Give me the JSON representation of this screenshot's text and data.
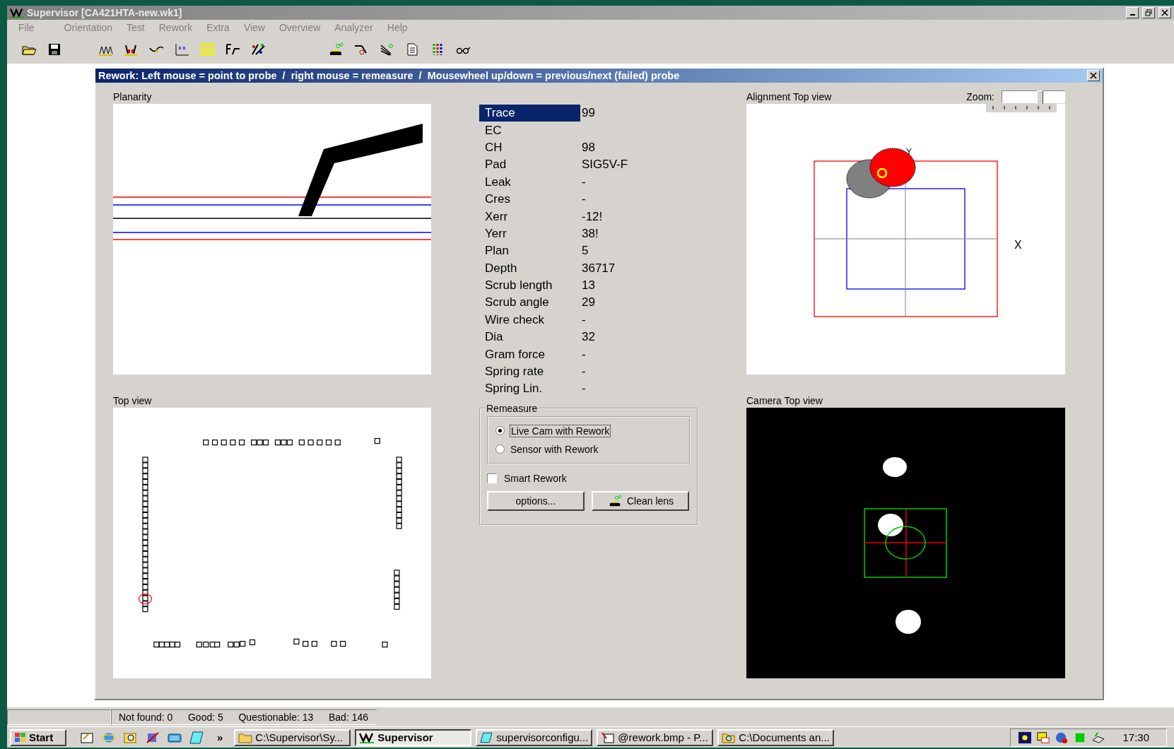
{
  "window": {
    "title": "Supervisor [CA421HTA-new.wk1]"
  },
  "menu": [
    "File",
    "Orientation",
    "Test",
    "Rework",
    "Extra",
    "View",
    "Overview",
    "Analyzer",
    "Help"
  ],
  "rework_panel": {
    "title": "Rework: Left mouse = point to probe  /  right mouse = remeasure  /  Mousewheel up/down = previous/next (failed) probe",
    "planarity": {
      "title": "Planarity"
    },
    "top_view": {
      "title": "Top view"
    },
    "alignment": {
      "title": "Alignment Top view",
      "zoom_label": "Zoom:",
      "zoom": {
        "level": 0.6
      },
      "y_axis": "Y",
      "x_axis": "X"
    },
    "camera": {
      "title": "Camera Top view"
    },
    "probe_info": [
      {
        "label": "Trace",
        "value": "99",
        "selected": true
      },
      {
        "label": "EC",
        "selected": false
      },
      {
        "label": "CH",
        "value": "98",
        "selected": false
      },
      {
        "label": "Pad",
        "value": "SIG5V-F",
        "selected": false
      },
      {
        "label": "Leak",
        "value": "-",
        "selected": false
      },
      {
        "label": "Cres",
        "value": "-",
        "selected": false
      },
      {
        "label": "Xerr",
        "value": "-12!",
        "selected": false
      },
      {
        "label": "Yerr",
        "value": "38!",
        "selected": false
      },
      {
        "label": "Plan",
        "value": "5",
        "selected": false
      },
      {
        "label": "Depth",
        "value": "36717",
        "selected": false
      },
      {
        "label": "Scrub length",
        "value": "13",
        "selected": false
      },
      {
        "label": "Scrub angle",
        "value": "29",
        "selected": false
      },
      {
        "label": "Wire check",
        "value": "-",
        "selected": false
      },
      {
        "label": "Dia",
        "value": "32",
        "selected": false
      },
      {
        "label": "Gram force",
        "value": "-",
        "selected": false
      },
      {
        "label": "Spring rate",
        "value": "-",
        "selected": false
      },
      {
        "label": "Spring Lin.",
        "value": "-",
        "selected": false
      }
    ],
    "remeasure": {
      "title": "Remeasure",
      "options": [
        {
          "label": "Live Cam with Rework",
          "selected": true
        },
        {
          "label": "Sensor with Rework",
          "selected": false
        }
      ],
      "smart_rework": {
        "label": "Smart Rework",
        "checked": false
      },
      "buttons": [
        {
          "label": "options...",
          "kind": "plain"
        },
        {
          "label": "Clean lens",
          "kind": "clean"
        }
      ]
    }
  },
  "status_bar": [
    "Not found: 0",
    "Good: 5",
    "Questionable: 13",
    "Bad: 146"
  ],
  "taskbar": {
    "start": "Start",
    "overflow": "»",
    "tasks": [
      {
        "label": "C:\\Supervisor\\Sy...",
        "kind": "folder",
        "selected": false
      },
      {
        "label": "Supervisor",
        "kind": "app",
        "selected": true
      },
      {
        "label": "supervisorconfigu...",
        "kind": "note",
        "selected": false
      },
      {
        "label": "@rework.bmp - P...",
        "kind": "paint",
        "selected": false
      },
      {
        "label": "C:\\Documents an...",
        "kind": "search",
        "selected": false
      }
    ],
    "clock": "17:30"
  }
}
